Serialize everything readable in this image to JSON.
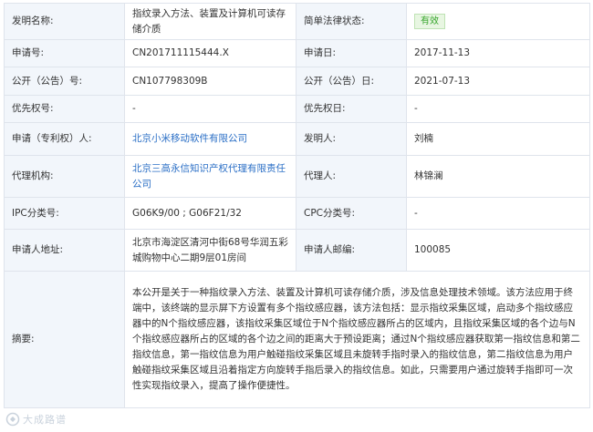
{
  "rows": {
    "title": {
      "label": "发明名称:",
      "value": "指纹录入方法、装置及计算机可读存储介质",
      "status_label": "简单法律状态:",
      "status": "有效"
    },
    "app_no": {
      "label": "申请号:",
      "value": "CN201711115444.X",
      "date_label": "申请日:",
      "date": "2017-11-13"
    },
    "pub_no": {
      "label": "公开（公告）号:",
      "value": "CN107798309B",
      "date_label": "公开（公告）日:",
      "date": "2021-07-13"
    },
    "priority": {
      "label": "优先权号:",
      "value": "-",
      "date_label": "优先权日:",
      "date": "-"
    },
    "applicant": {
      "label": "申请（专利权）人:",
      "value": "北京小米移动软件有限公司",
      "inventor_label": "发明人:",
      "inventor": "刘楠"
    },
    "agency": {
      "label": "代理机构:",
      "value": "北京三高永信知识产权代理有限责任公司",
      "agent_label": "代理人:",
      "agent": "林锦澜"
    },
    "ipc": {
      "label": "IPC分类号:",
      "value": "G06K9/00 ;   G06F21/32",
      "cpc_label": "CPC分类号:",
      "cpc": "-"
    },
    "address": {
      "label": "申请人地址:",
      "value": "北京市海淀区清河中街68号华润五彩城购物中心二期9层01房间",
      "postcode_label": "申请人邮编:",
      "postcode": "100085"
    },
    "abstract": {
      "label": "摘要:",
      "value": "本公开是关于一种指纹录入方法、装置及计算机可读存储介质，涉及信息处理技术领域。该方法应用于终端中，该终端的显示屏下方设置有多个指纹感应器，该方法包括：显示指纹采集区域，启动多个指纹感应器中的N个指纹感应器，该指纹采集区域位于N个指纹感应器所占的区域内，且指纹采集区域的各个边与N个指纹感应器所占的区域的各个边之间的距离大于预设距离；通过N个指纹感应器获取第一指纹信息和第二指纹信息，第一指纹信息为用户触碰指纹采集区域且未旋转手指时录入的指纹信息，第二指纹信息为用户触碰指纹采集区域且沿着指定方向旋转手指后录入的指纹信息。如此，只需要用户通过旋转手指即可一次性实现指纹录入，提高了操作便捷性。"
    }
  },
  "watermark": {
    "text": "大成路谱"
  }
}
